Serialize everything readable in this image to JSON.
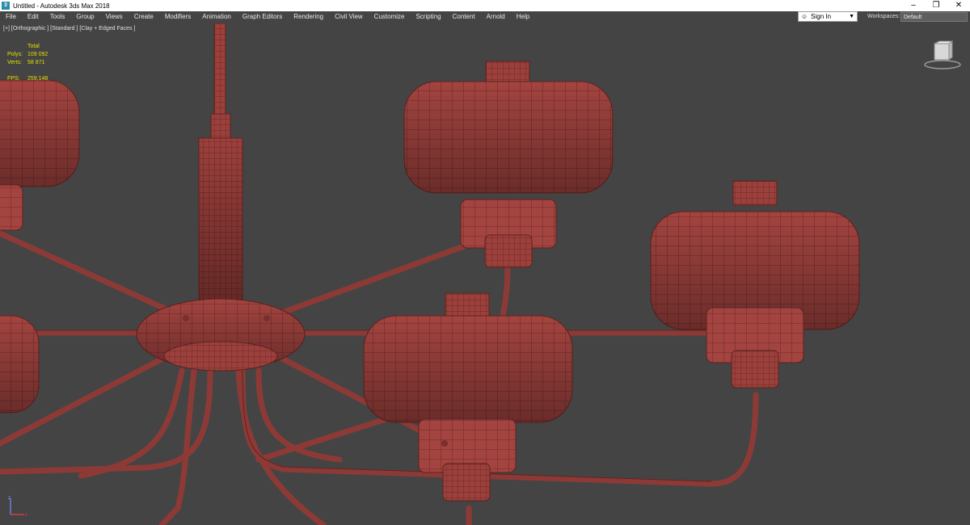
{
  "window": {
    "title": "Untitled - Autodesk 3ds Max 2018",
    "controls": [
      "–",
      "❐",
      "✕"
    ]
  },
  "menu": {
    "items": [
      "File",
      "Edit",
      "Tools",
      "Group",
      "Views",
      "Create",
      "Modifiers",
      "Animation",
      "Graph Editors",
      "Rendering",
      "Civil View",
      "Customize",
      "Scripting",
      "Content",
      "Arnold",
      "Help"
    ]
  },
  "account": {
    "sign_in": "Sign In"
  },
  "workspaces": {
    "label": "Workspaces:",
    "value": "Default"
  },
  "viewport": {
    "label": "[+] [Orthographic ] [Standard ] [Clay + Edged Faces ]",
    "stats": {
      "header": "Total",
      "polys_label": "Polys:",
      "polys_value": "109 092",
      "verts_label": "Verts:",
      "verts_value": "58 871",
      "fps_label": "FPS:",
      "fps_value": "259,148"
    },
    "colors": {
      "model": "#a34440",
      "model_dark": "#6b2826",
      "background": "#444444",
      "stats_text": "#e0e000"
    }
  }
}
